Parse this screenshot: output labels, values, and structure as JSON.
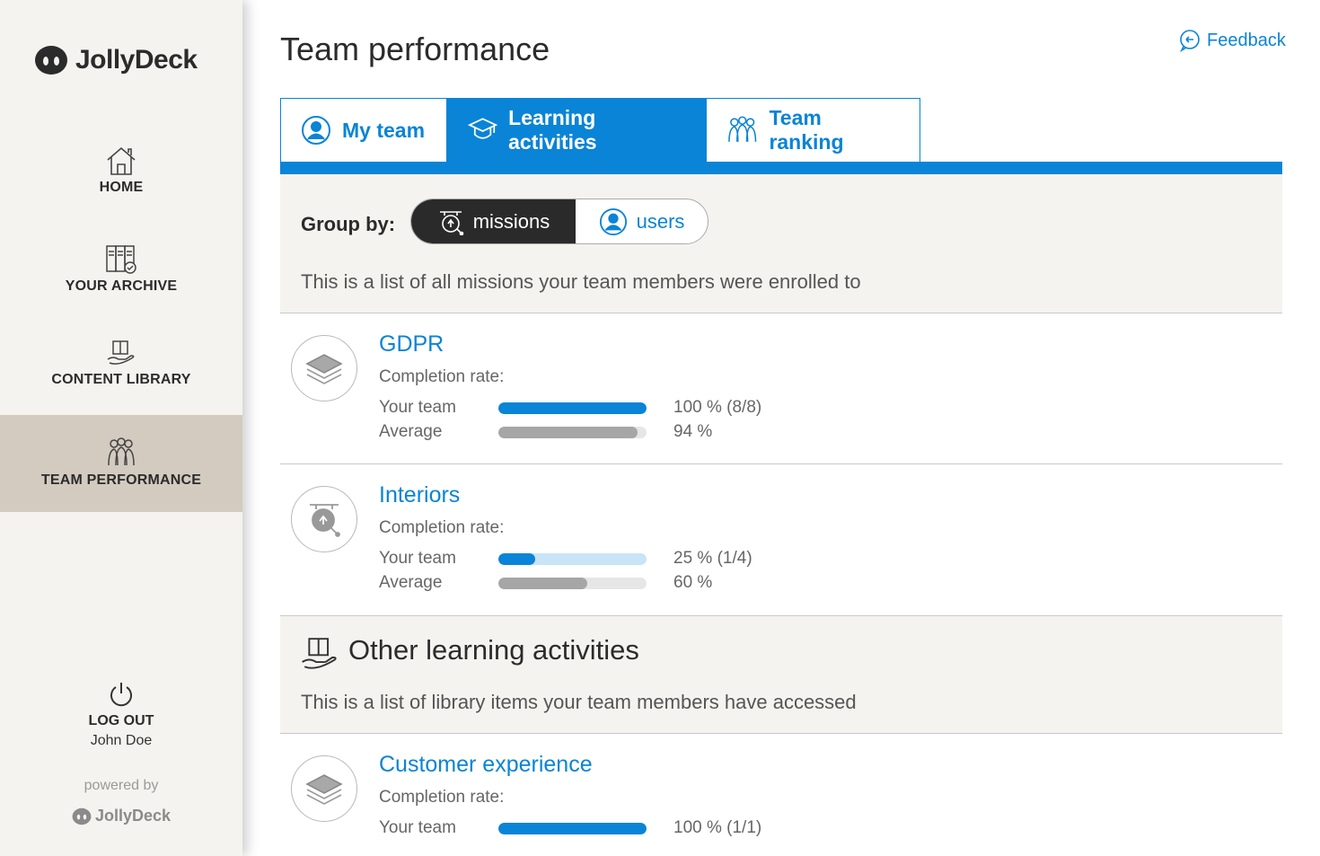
{
  "brand": {
    "name": "JollyDeck"
  },
  "sidebar": {
    "items": [
      {
        "label": "HOME",
        "icon": "home-icon"
      },
      {
        "label": "YOUR ARCHIVE",
        "icon": "archive-icon"
      },
      {
        "label": "CONTENT LIBRARY",
        "icon": "book-hand-icon"
      },
      {
        "label": "TEAM PERFORMANCE",
        "icon": "team-icon",
        "active": true
      }
    ],
    "logout_label": "LOG OUT",
    "user_name": "John Doe",
    "powered_by": "powered by",
    "powered_brand": "JollyDeck"
  },
  "header": {
    "title": "Team performance",
    "feedback_label": "Feedback"
  },
  "tabs": [
    {
      "label": "My team",
      "icon": "user-circle-icon",
      "active": false
    },
    {
      "label": "Learning activities",
      "icon": "graduation-cap-icon",
      "active": true
    },
    {
      "label": "Team ranking",
      "icon": "team-ranking-icon",
      "active": false
    }
  ],
  "group_by": {
    "label": "Group by:",
    "options": [
      {
        "label": "missions",
        "selected": true
      },
      {
        "label": "users",
        "selected": false
      }
    ],
    "description": "This is a list of all missions your team members were enrolled to"
  },
  "missions": [
    {
      "name": "GDPR",
      "completion_label": "Completion rate:",
      "team_label": "Your team",
      "team_value": "100 % (8/8)",
      "team_fraction": 1.0,
      "average_label": "Average",
      "average_value": "94 %",
      "average_fraction": 0.94
    },
    {
      "name": "Interiors",
      "completion_label": "Completion rate:",
      "team_label": "Your team",
      "team_value": "25 % (1/4)",
      "team_fraction": 0.25,
      "average_label": "Average",
      "average_value": "60 %",
      "average_fraction": 0.6
    }
  ],
  "other": {
    "title": "Other learning activities",
    "description": "This is a list of library items your team members have accessed",
    "items": [
      {
        "name": "Customer experience",
        "completion_label": "Completion rate:",
        "team_label": "Your team",
        "team_value": "100 % (1/1)",
        "team_fraction": 1.0
      }
    ]
  },
  "colors": {
    "accent": "#0a84d6",
    "sidebar_bg": "#f5f3ef",
    "active_nav": "#d3cbbf",
    "dark_toggle": "#2a2a2a"
  }
}
